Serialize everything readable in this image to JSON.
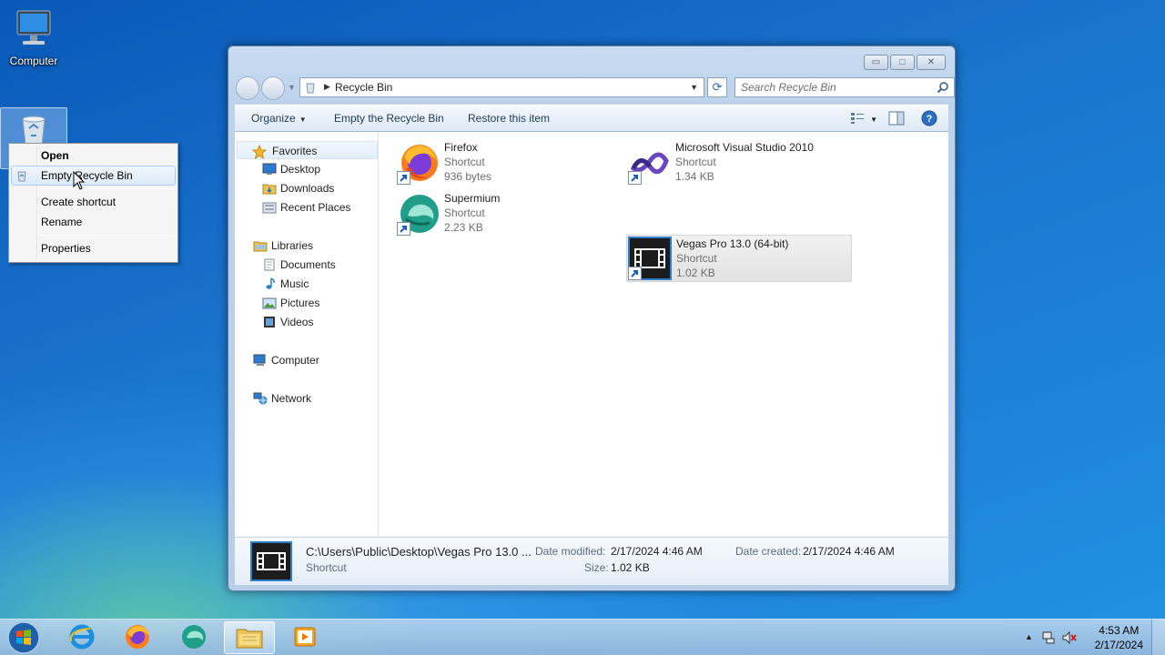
{
  "desktop": {
    "computer_label": "Computer",
    "recycle_label": "Recycle Bin"
  },
  "context_menu": {
    "items": [
      {
        "label": "Open",
        "bold": true
      },
      {
        "label": "Empty Recycle Bin",
        "hover": true
      },
      {
        "label": "Create shortcut"
      },
      {
        "label": "Rename"
      },
      {
        "label": "Properties"
      }
    ]
  },
  "window": {
    "address": "Recycle Bin",
    "search_placeholder": "Search Recycle Bin",
    "commands": {
      "organize": "Organize",
      "empty": "Empty the Recycle Bin",
      "restore": "Restore this item"
    }
  },
  "nav": {
    "favorites": "Favorites",
    "desktop": "Desktop",
    "downloads": "Downloads",
    "recent": "Recent Places",
    "libraries": "Libraries",
    "documents": "Documents",
    "music": "Music",
    "pictures": "Pictures",
    "videos": "Videos",
    "computer": "Computer",
    "network": "Network"
  },
  "files": [
    {
      "name": "Firefox",
      "type": "Shortcut",
      "size": "936 bytes"
    },
    {
      "name": "Microsoft Visual Studio 2010",
      "type": "Shortcut",
      "size": "1.34 KB"
    },
    {
      "name": "Supermium",
      "type": "Shortcut",
      "size": "2.23 KB"
    },
    {
      "name": "Vegas Pro 13.0 (64-bit)",
      "type": "Shortcut",
      "size": "1.02 KB"
    }
  ],
  "details": {
    "path": "C:\\Users\\Public\\Desktop\\Vegas Pro 13.0 ...",
    "type": "Shortcut",
    "modified_label": "Date modified:",
    "modified_value": "2/17/2024 4:46 AM",
    "size_label": "Size:",
    "size_value": "1.02 KB",
    "created_label": "Date created:",
    "created_value": "2/17/2024 4:46 AM"
  },
  "taskbar": {
    "time": "4:53 AM",
    "date": "2/17/2024"
  },
  "colors": {
    "selection_blue": "#aeccf1",
    "window_frame": "#bdd3ec",
    "link_text": "#1e3957"
  }
}
